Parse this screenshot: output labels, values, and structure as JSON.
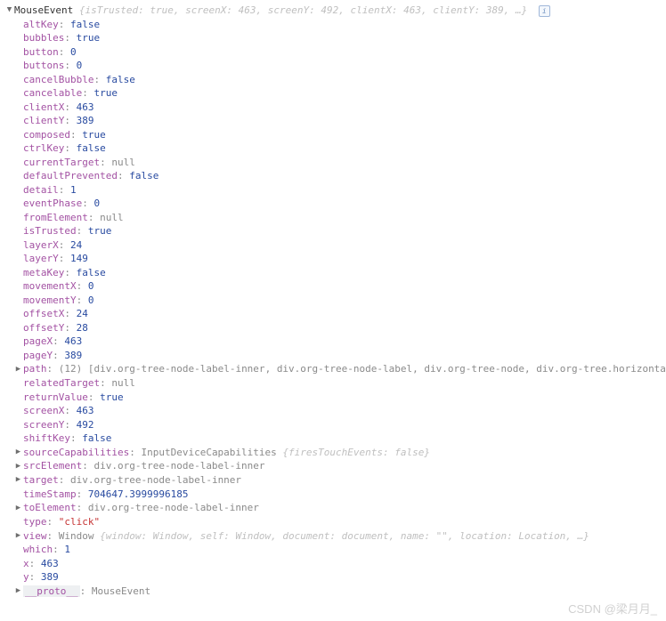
{
  "header": {
    "className": "MouseEvent",
    "preview": [
      {
        "k": "isTrusted",
        "v": "true",
        "t": "bool"
      },
      {
        "k": "screenX",
        "v": "463",
        "t": "num"
      },
      {
        "k": "screenY",
        "v": "492",
        "t": "num"
      },
      {
        "k": "clientX",
        "v": "463",
        "t": "num"
      },
      {
        "k": "clientY",
        "v": "389",
        "t": "num"
      }
    ],
    "ellipsis": "…"
  },
  "props": [
    {
      "k": "altKey",
      "v": "false",
      "t": "bool"
    },
    {
      "k": "bubbles",
      "v": "true",
      "t": "bool"
    },
    {
      "k": "button",
      "v": "0",
      "t": "num"
    },
    {
      "k": "buttons",
      "v": "0",
      "t": "num"
    },
    {
      "k": "cancelBubble",
      "v": "false",
      "t": "bool"
    },
    {
      "k": "cancelable",
      "v": "true",
      "t": "bool"
    },
    {
      "k": "clientX",
      "v": "463",
      "t": "num"
    },
    {
      "k": "clientY",
      "v": "389",
      "t": "num"
    },
    {
      "k": "composed",
      "v": "true",
      "t": "bool"
    },
    {
      "k": "ctrlKey",
      "v": "false",
      "t": "bool"
    },
    {
      "k": "currentTarget",
      "v": "null",
      "t": "nullv"
    },
    {
      "k": "defaultPrevented",
      "v": "false",
      "t": "bool"
    },
    {
      "k": "detail",
      "v": "1",
      "t": "num"
    },
    {
      "k": "eventPhase",
      "v": "0",
      "t": "num"
    },
    {
      "k": "fromElement",
      "v": "null",
      "t": "nullv"
    },
    {
      "k": "isTrusted",
      "v": "true",
      "t": "bool"
    },
    {
      "k": "layerX",
      "v": "24",
      "t": "num"
    },
    {
      "k": "layerY",
      "v": "149",
      "t": "num"
    },
    {
      "k": "metaKey",
      "v": "false",
      "t": "bool"
    },
    {
      "k": "movementX",
      "v": "0",
      "t": "num"
    },
    {
      "k": "movementY",
      "v": "0",
      "t": "num"
    },
    {
      "k": "offsetX",
      "v": "24",
      "t": "num"
    },
    {
      "k": "offsetY",
      "v": "28",
      "t": "num"
    },
    {
      "k": "pageX",
      "v": "463",
      "t": "num"
    },
    {
      "k": "pageY",
      "v": "389",
      "t": "num"
    }
  ],
  "pathRow": {
    "key": "path",
    "count": "(12)",
    "items": [
      "div.org-tree-node-label-inner",
      "div.org-tree-node-label",
      "div.org-tree-node",
      "div.org-tree.horizonta"
    ]
  },
  "props2": [
    {
      "k": "relatedTarget",
      "v": "null",
      "t": "nullv"
    },
    {
      "k": "returnValue",
      "v": "true",
      "t": "bool"
    },
    {
      "k": "screenX",
      "v": "463",
      "t": "num"
    },
    {
      "k": "screenY",
      "v": "492",
      "t": "num"
    },
    {
      "k": "shiftKey",
      "v": "false",
      "t": "bool"
    }
  ],
  "srcCaps": {
    "key": "sourceCapabilities",
    "cls": "InputDeviceCapabilities",
    "previewKey": "firesTouchEvents",
    "previewVal": "false"
  },
  "elemRows": [
    {
      "k": "srcElement",
      "v": "div.org-tree-node-label-inner",
      "arrow": true
    },
    {
      "k": "target",
      "v": "div.org-tree-node-label-inner",
      "arrow": true
    }
  ],
  "timeStamp": {
    "k": "timeStamp",
    "v": "704647.3999996185"
  },
  "toElement": {
    "k": "toElement",
    "v": "div.org-tree-node-label-inner"
  },
  "typeRow": {
    "k": "type",
    "v": "\"click\""
  },
  "viewRow": {
    "key": "view",
    "cls": "Window",
    "parts": [
      {
        "k": "window",
        "v": "Window"
      },
      {
        "k": "self",
        "v": "Window"
      },
      {
        "k": "document",
        "v": "document"
      },
      {
        "k": "name",
        "v": "\"\"",
        "str": true
      },
      {
        "k": "location",
        "v": "Location"
      }
    ],
    "ellipsis": "…"
  },
  "props3": [
    {
      "k": "which",
      "v": "1",
      "t": "num"
    },
    {
      "k": "x",
      "v": "463",
      "t": "num"
    },
    {
      "k": "y",
      "v": "389",
      "t": "num"
    }
  ],
  "proto": {
    "k": "__proto__",
    "v": "MouseEvent"
  },
  "watermark": "CSDN @梁月月_"
}
